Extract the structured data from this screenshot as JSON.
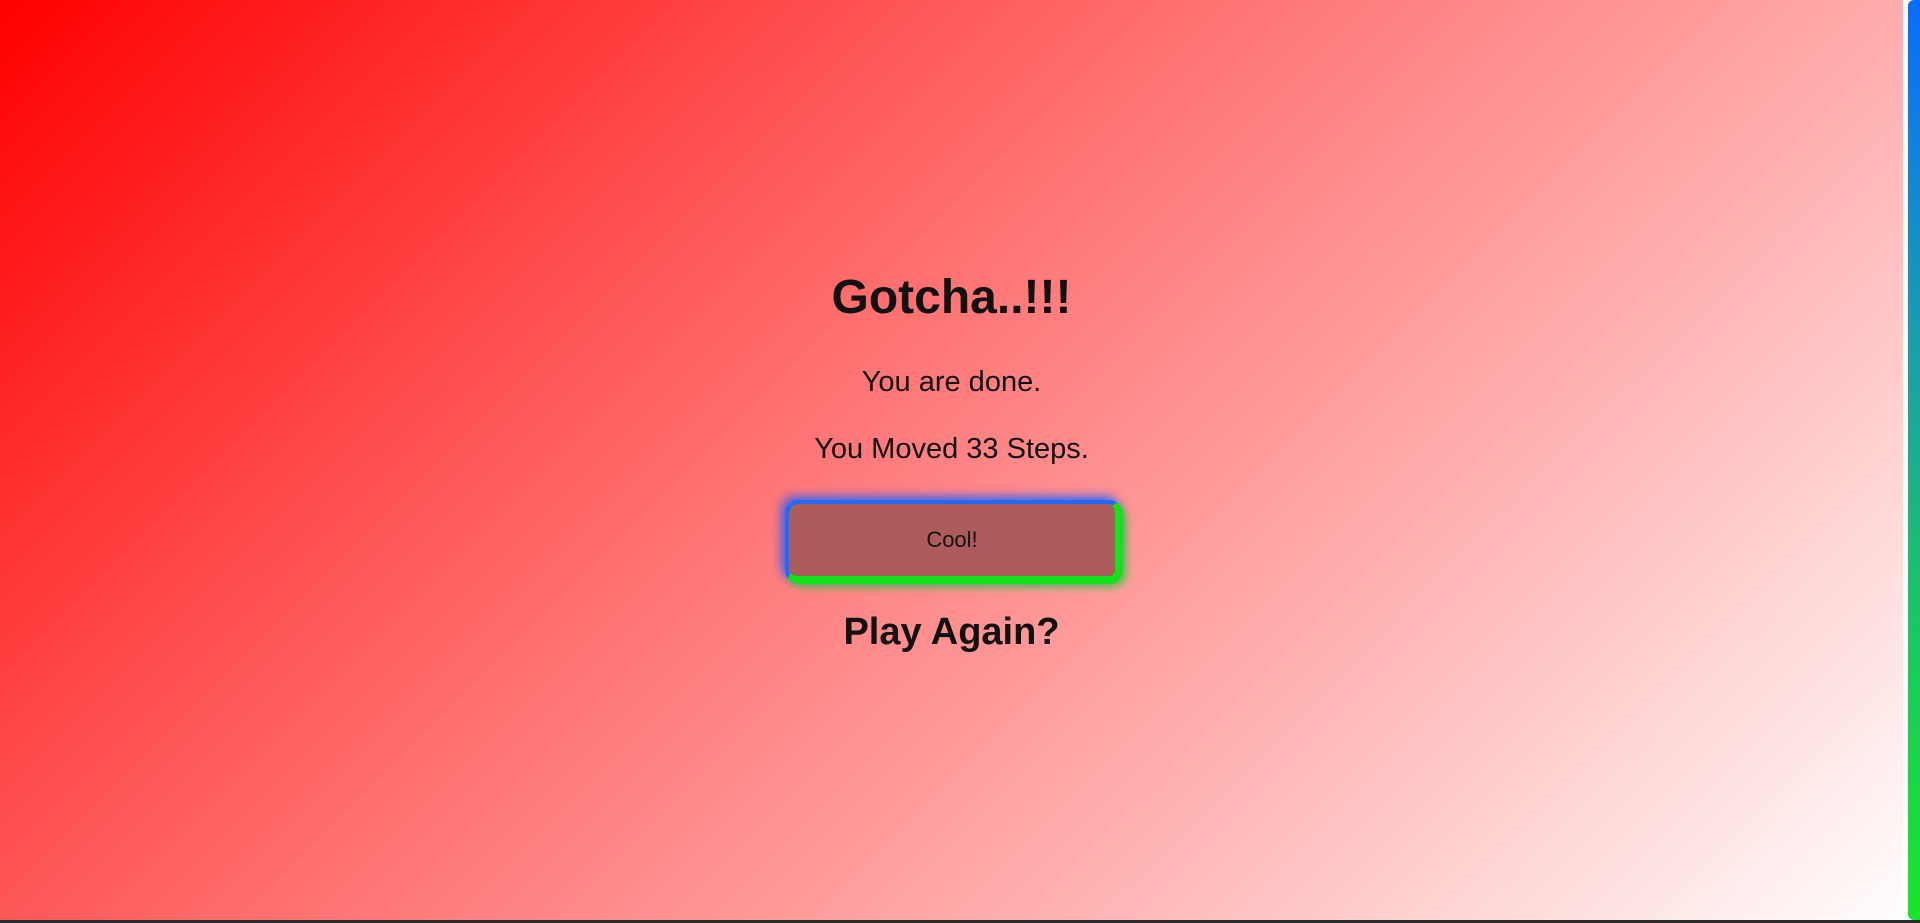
{
  "game_over": {
    "title": "Gotcha..!!!",
    "done_message": "You are done.",
    "steps_message": "You Moved 33 Steps.",
    "cool_button_label": "Cool!",
    "play_again_label": "Play Again?"
  },
  "colors": {
    "background_start": "#ff0000",
    "background_end": "#ffffff",
    "button_fill": "#ad5c5c",
    "button_border_blue": "#1f6bff",
    "button_border_green": "#12e21a",
    "scrollbar_top": "#0a6cff",
    "scrollbar_bottom": "#16e62a"
  }
}
